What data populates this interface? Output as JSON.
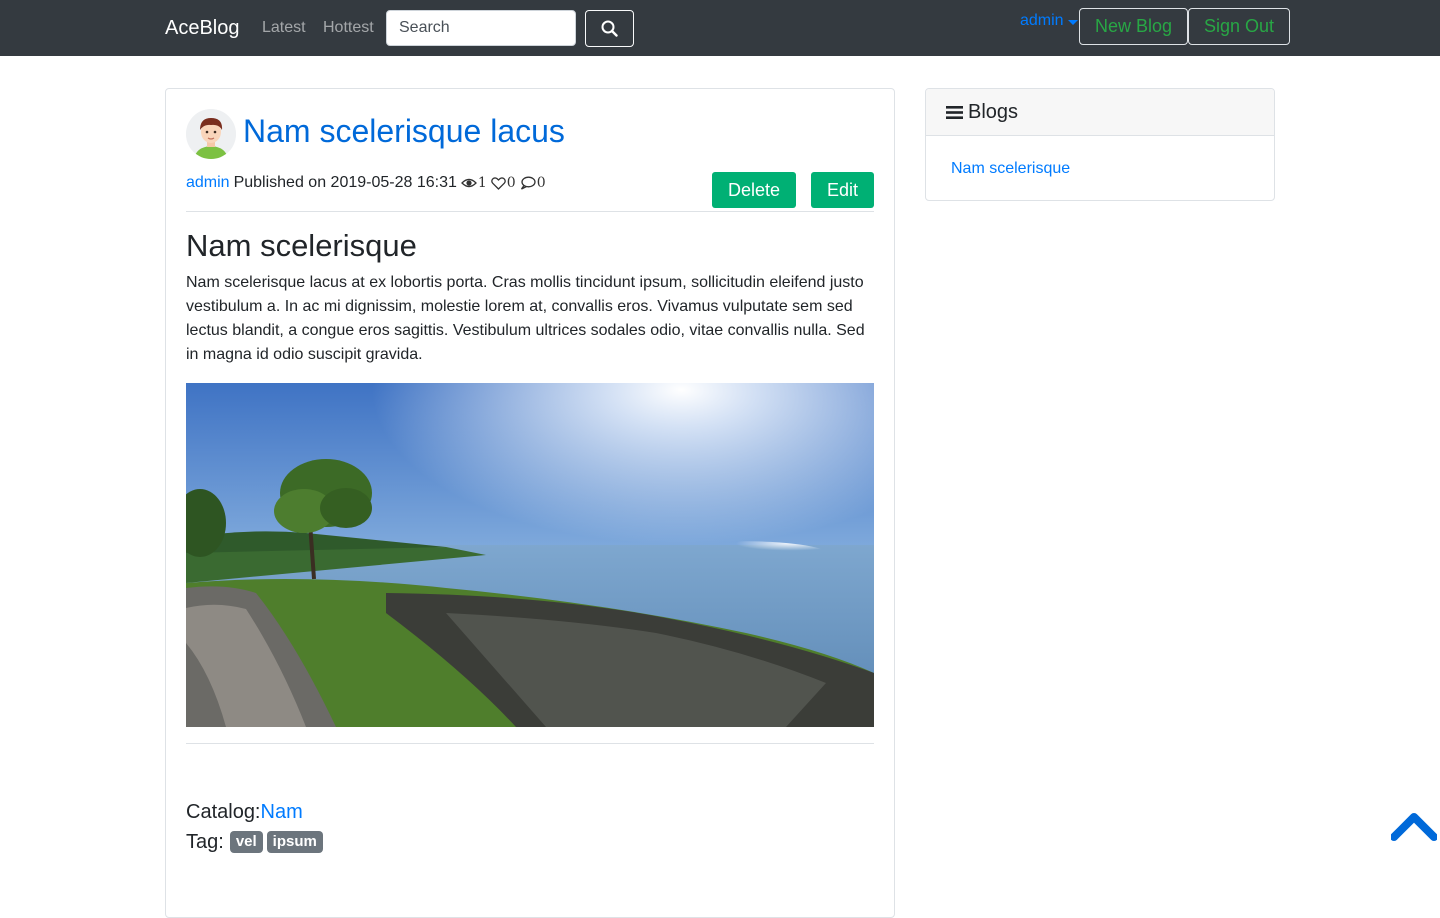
{
  "navbar": {
    "brand": "AceBlog",
    "links": [
      "Latest",
      "Hottest"
    ],
    "search_placeholder": "Search",
    "user": "admin",
    "new_blog": "New Blog",
    "sign_out": "Sign Out"
  },
  "post": {
    "title": "Nam scelerisque lacus",
    "author": "admin",
    "published": "Published on 2019-05-28 16:31",
    "views": "1",
    "likes": "0",
    "comments": "0",
    "delete_label": "Delete",
    "edit_label": "Edit",
    "heading": "Nam scelerisque",
    "body": "Nam scelerisque lacus at ex lobortis porta. Cras mollis tincidunt ipsum, sollicitudin eleifend justo vestibulum a. In ac mi dignissim, molestie lorem at, convallis eros. Vivamus vulputate sem sed lectus blandit, a congue eros sagittis. Vestibulum ultrices sodales odio, vitae convallis nulla. Sed in magna id odio suscipit gravida.",
    "catalog_label": "Catalog:",
    "catalog": "Nam",
    "tag_label": "Tag:",
    "tags": [
      "vel",
      "ipsum"
    ]
  },
  "sidebar": {
    "title": "Blogs",
    "items": [
      "Nam scelerisque"
    ]
  },
  "colors": {
    "navbar_bg": "#343a40",
    "link": "#007bff",
    "action_green": "#00b074",
    "outline_green": "#28a745",
    "badge": "#6c757d"
  },
  "icons": [
    "search-icon",
    "caret-down-icon",
    "eye-icon",
    "heart-icon",
    "comment-icon",
    "bars-icon",
    "chevron-up-icon"
  ]
}
